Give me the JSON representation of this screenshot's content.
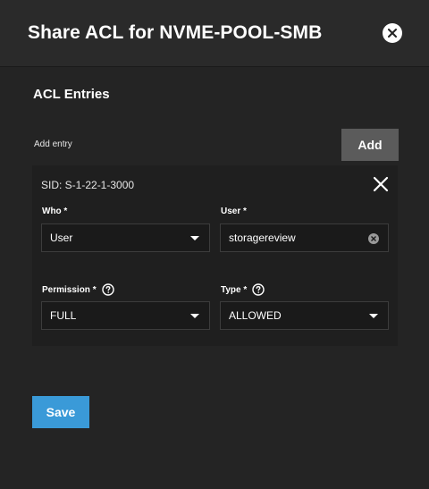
{
  "dialog": {
    "title": "Share ACL for NVME-POOL-SMB",
    "close_icon": "close-circle-icon"
  },
  "acl": {
    "section_title": "ACL Entries",
    "add_entry_label": "Add entry",
    "add_label": "Add",
    "entry": {
      "sid": "SID: S-1-22-1-3000",
      "remove_icon": "close-icon",
      "who": {
        "label": "Who *",
        "value": "User"
      },
      "user": {
        "label": "User *",
        "value": "storagereview"
      },
      "permission": {
        "label": "Permission *",
        "value": "FULL"
      },
      "type": {
        "label": "Type *",
        "value": "ALLOWED"
      }
    }
  },
  "footer": {
    "save_label": "Save"
  },
  "colors": {
    "save_accent": "#3a9ad8",
    "add_button": "#5b5b5b",
    "background": "#242424"
  }
}
